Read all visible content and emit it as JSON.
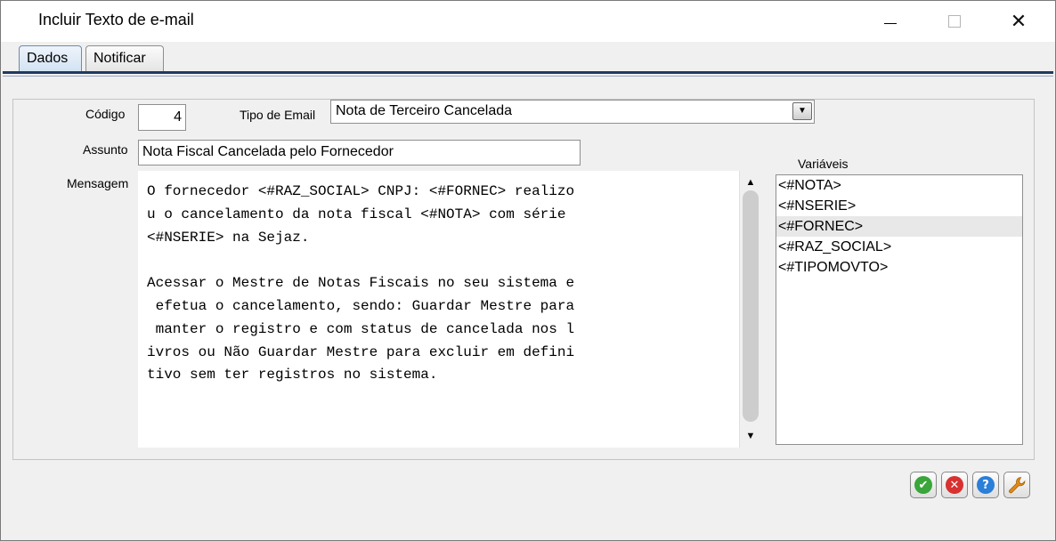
{
  "window": {
    "title": "Incluir Texto de e-mail",
    "minimize_glyph": "—",
    "close_glyph": "✕"
  },
  "tabs": [
    {
      "label": "Dados",
      "active": true
    },
    {
      "label": "Notificar",
      "active": false
    }
  ],
  "form": {
    "codigo_label": "Código",
    "codigo_value": "4",
    "tipo_label": "Tipo de Email",
    "tipo_value": "Nota de Terceiro Cancelada",
    "assunto_label": "Assunto",
    "assunto_value": "Nota Fiscal Cancelada pelo Fornecedor",
    "mensagem_label": "Mensagem",
    "mensagem_lines": [
      "O fornecedor <#RAZ_SOCIAL> CNPJ: <#FORNEC> realizo",
      "u o cancelamento da nota fiscal <#NOTA> com série",
      "<#NSERIE> na Sejaz.",
      "",
      "Acessar o Mestre de Notas Fiscais no seu sistema e",
      " efetua o cancelamento, sendo: Guardar Mestre para",
      " manter o registro e com status de cancelada nos l",
      "ivros ou Não Guardar Mestre para excluir em defini",
      "tivo sem ter registros no sistema."
    ]
  },
  "variaveis": {
    "label": "Variáveis",
    "items": [
      "<#NOTA>",
      "<#NSERIE>",
      "<#FORNEC>",
      "<#RAZ_SOCIAL>",
      "<#TIPOMOVTO>"
    ],
    "selected_index": 2
  },
  "actions": {
    "confirm_icon": "check-icon",
    "cancel_icon": "cancel-icon",
    "help_icon": "help-icon",
    "tools_icon": "wrench-icon",
    "colors": {
      "confirm": "#3aa53a",
      "cancel": "#d93030",
      "help": "#2a7fd8",
      "tools": "#e08a1a"
    }
  },
  "glyphs": {
    "dropdown": "▼",
    "scroll_up": "▲",
    "scroll_down": "▼",
    "check": "✔",
    "cross": "✕",
    "question": "?"
  }
}
